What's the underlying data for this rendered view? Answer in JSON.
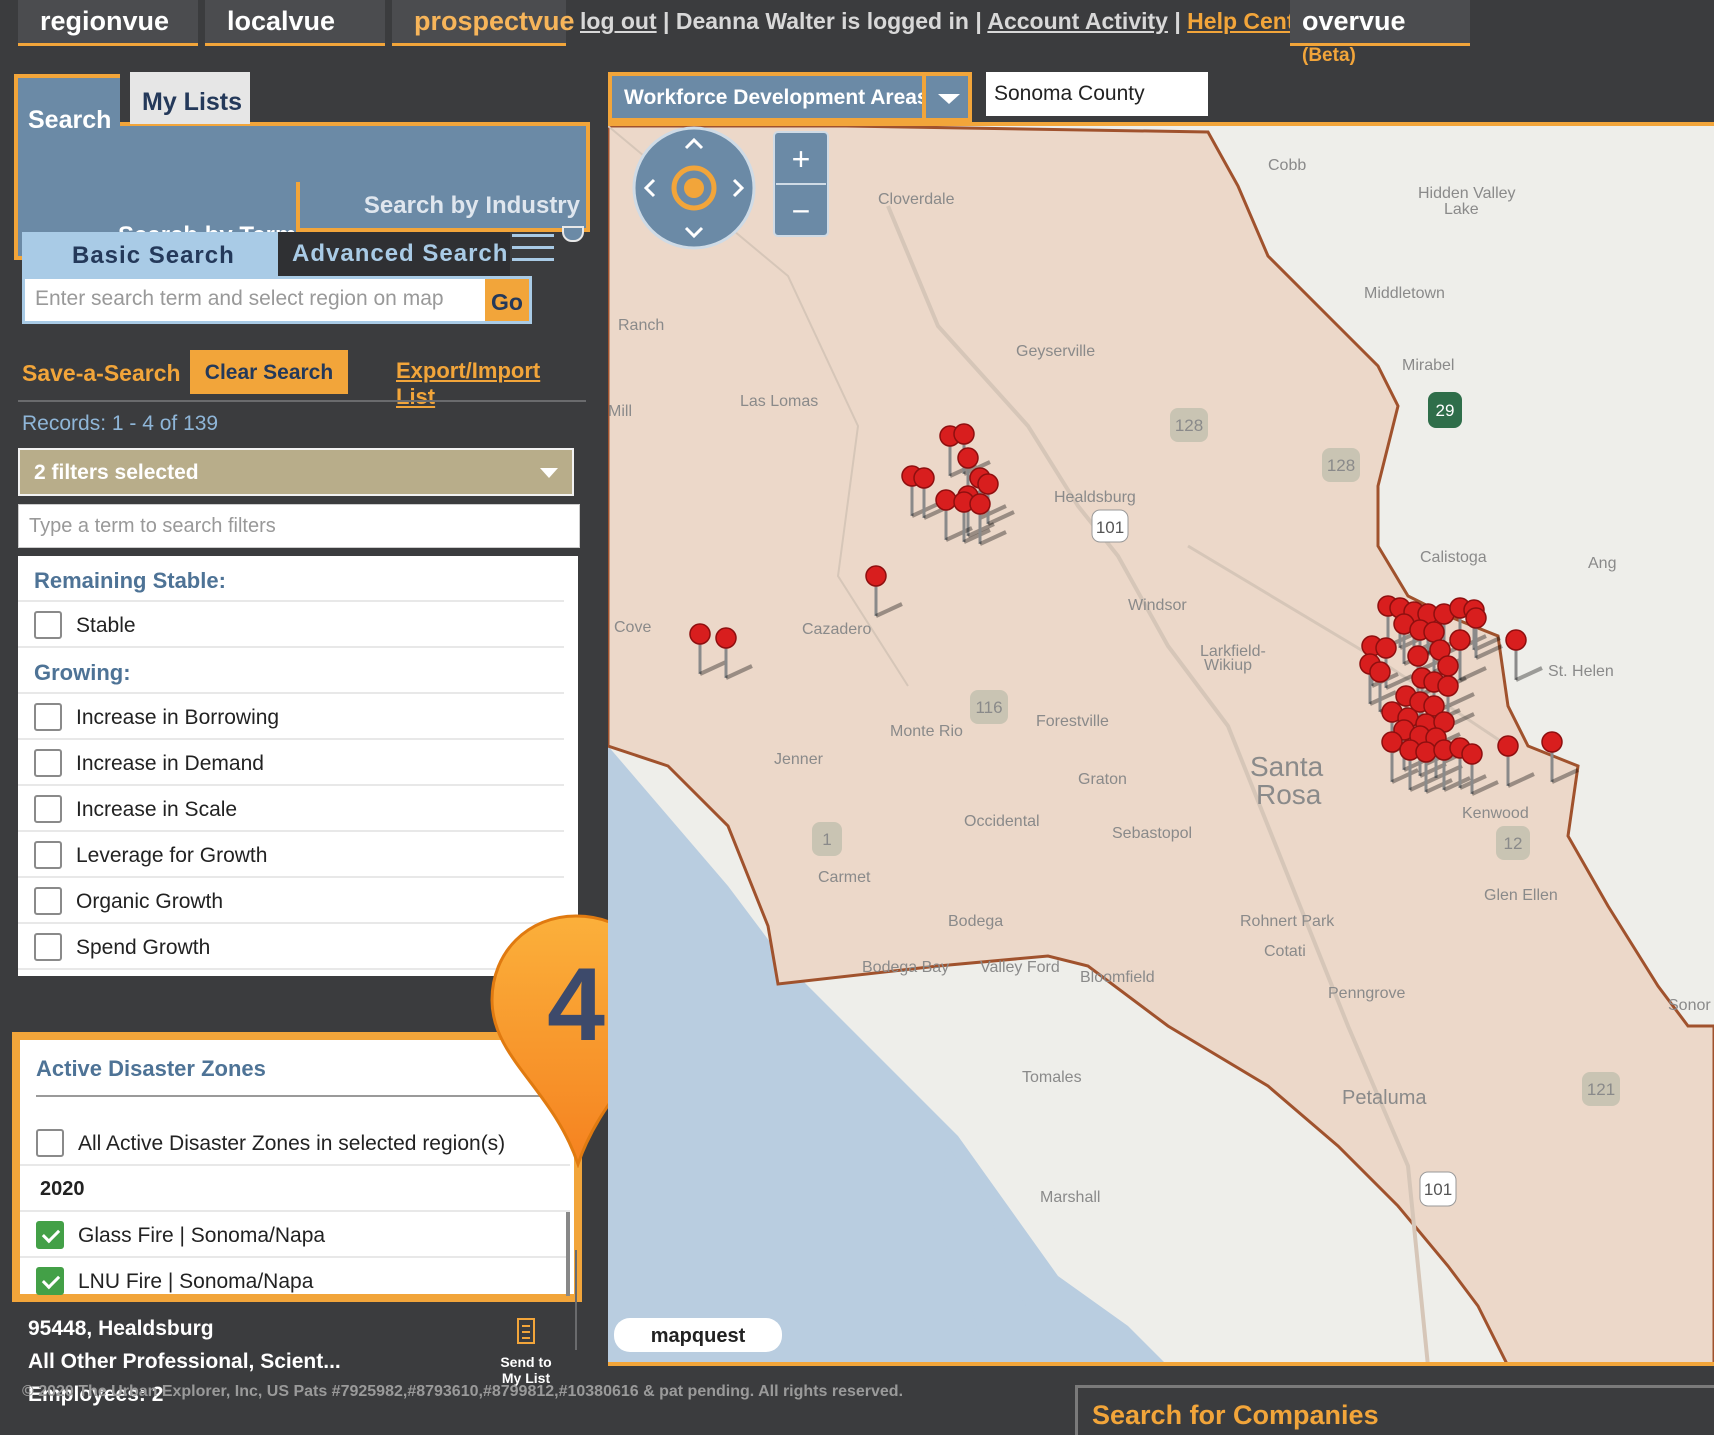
{
  "nav": {
    "tabs": [
      "regionvue",
      "localvue",
      "prospectvue"
    ],
    "logout": "log out",
    "logged_in_text": "Deanna Walter is logged in",
    "account_activity": "Account Activity",
    "help_center": "Help Center",
    "overvue": "overvue",
    "beta": "(Beta)"
  },
  "panel": {
    "tab_search": "Search",
    "tab_mylists": "My Lists",
    "by_industry": "Search by Industry",
    "by_term": "Search by Term",
    "basic_search": "Basic Search",
    "advanced_search": "Advanced Search",
    "search_placeholder": "Enter search term and select region on map",
    "go": "Go",
    "save_search": "Save-a-Search",
    "clear_search": "Clear Search",
    "export_import": "Export/Import List",
    "records": "Records: 1 - 4 of 139",
    "filters_selected": "2 filters selected",
    "filter_placeholder": "Type a term to search filters"
  },
  "filters": {
    "remaining_stable": "Remaining Stable:",
    "stable": "Stable",
    "growing": "Growing:",
    "increase_borrowing": "Increase in Borrowing",
    "increase_demand": "Increase in Demand",
    "increase_scale": "Increase in Scale",
    "leverage_growth": "Leverage for Growth",
    "organic_growth": "Organic Growth",
    "spend_growth": "Spend Growth"
  },
  "disaster": {
    "title": "Active Disaster Zones",
    "all_label": "All Active Disaster Zones in selected region(s)",
    "year": "2020",
    "glass_fire": "Glass Fire | Sonoma/Napa",
    "lnu_fire": "LNU Fire | Sonoma/Napa"
  },
  "callout_number": "4",
  "result": {
    "line1": "95448, Healdsburg",
    "line2": "All Other Professional, Scient...",
    "line3": "Employees: 2",
    "send_to": "Send to",
    "my_list": "My List"
  },
  "footer": "© 2020 The Urban Explorer, Inc, US Pats #7925982,#8793610,#8799812,#10380616 & pat pending. All rights reserved.",
  "search_companies": "Search for Companies",
  "map": {
    "area_selector": "Workforce Development Areas",
    "county": "Sonoma County",
    "zoom_in": "+",
    "zoom_out": "−",
    "attribution": "mapquest",
    "places": [
      "Cobb",
      "Hidden Valley",
      "Lake",
      "Cloverdale",
      "Middletown",
      "Mirabel",
      "Ranch",
      "Geyserville",
      "Las Lomas",
      "Mill",
      "Healdsburg",
      "Calistoga",
      "Ang",
      "Windsor",
      "Cove",
      "Cazadero",
      "Larkfield-",
      "Wikiup",
      "St. Helen",
      "Monte Rio",
      "Forestville",
      "Jenner",
      "Santa",
      "Rosa",
      "Graton",
      "Kenwood",
      "Occidental",
      "Sebastopol",
      "Carmet",
      "Glen Ellen",
      "Bodega",
      "Rohnert Park",
      "Cotati",
      "Bodega Bay",
      "Valley Ford",
      "Bloomfield",
      "Penngrove",
      "Sonor",
      "Tomales",
      "Petaluma",
      "Marshall"
    ],
    "shields": [
      "29",
      "128",
      "128",
      "101",
      "116",
      "1",
      "12",
      "101",
      "121"
    ]
  }
}
